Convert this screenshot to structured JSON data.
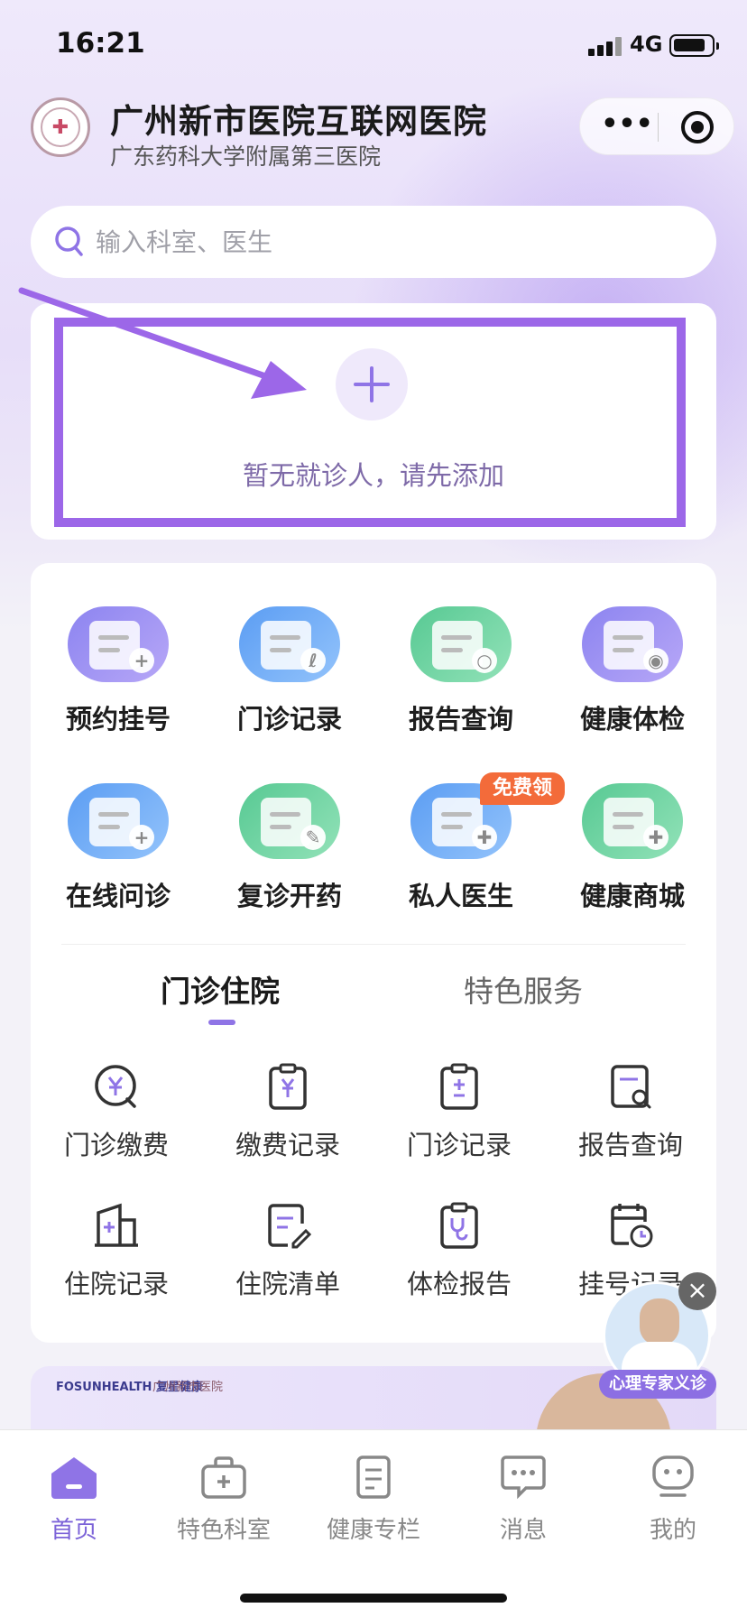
{
  "status_bar": {
    "time": "16:21",
    "network": "4G"
  },
  "header": {
    "title": "广州新市医院互联网医院",
    "subtitle": "广东药科大学附属第三医院",
    "logo_icon": "hospital-logo"
  },
  "search": {
    "placeholder": "输入科室、医生"
  },
  "patient": {
    "empty_text": "暂无就诊人，请先添加"
  },
  "services": [
    {
      "label": "预约挂号",
      "icon": "calendar-add-icon",
      "color": "purple"
    },
    {
      "label": "门诊记录",
      "icon": "record-stethoscope-icon",
      "color": "blue"
    },
    {
      "label": "报告查询",
      "icon": "report-search-icon",
      "color": "green"
    },
    {
      "label": "健康体检",
      "icon": "building-location-icon",
      "color": "purple"
    },
    {
      "label": "在线问诊",
      "icon": "chat-add-icon",
      "color": "blue"
    },
    {
      "label": "复诊开药",
      "icon": "prescription-icon",
      "color": "green"
    },
    {
      "label": "私人医生",
      "icon": "doctor-icon",
      "color": "blue",
      "badge": "免费领"
    },
    {
      "label": "健康商城",
      "icon": "shop-icon",
      "color": "green"
    }
  ],
  "tabs": {
    "active": "门诊住院",
    "inactive": "特色服务"
  },
  "outpatient": [
    {
      "label": "门诊缴费",
      "icon": "yuan-payment-icon"
    },
    {
      "label": "缴费记录",
      "icon": "payment-clipboard-icon"
    },
    {
      "label": "门诊记录",
      "icon": "clipboard-plusminus-icon"
    },
    {
      "label": "报告查询",
      "icon": "document-search-icon"
    },
    {
      "label": "住院记录",
      "icon": "hospital-building-icon"
    },
    {
      "label": "住院清单",
      "icon": "document-edit-icon"
    },
    {
      "label": "体检报告",
      "icon": "clipboard-stethoscope-icon"
    },
    {
      "label": "挂号记录",
      "icon": "calendar-clock-icon"
    }
  ],
  "promo": {
    "brand": "FOSUNHEALTH 复星健康",
    "hospital": "广州新市医院"
  },
  "floating": {
    "label": "心理专家义诊"
  },
  "tabbar": [
    {
      "label": "首页",
      "icon": "home-icon",
      "active": true
    },
    {
      "label": "特色科室",
      "icon": "medical-kit-icon"
    },
    {
      "label": "健康专栏",
      "icon": "article-icon"
    },
    {
      "label": "消息",
      "icon": "message-icon"
    },
    {
      "label": "我的",
      "icon": "profile-icon"
    }
  ],
  "colors": {
    "accent": "#8f74e6",
    "highlight_frame": "#9c67e8",
    "badge": "#f36b3a"
  }
}
